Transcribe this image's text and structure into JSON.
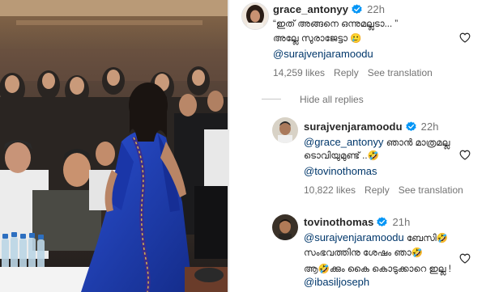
{
  "comments": [
    {
      "username": "grace_antonyy",
      "time": "22h",
      "lines": [
        "“ഇത് അങ്ങനെ ഒന്നുമല്ലടാ... ”",
        "അല്ലേ സുരാജേട്ടാ 🥲"
      ],
      "mention": "@surajvenjaramoodu",
      "likes": "14,259 likes",
      "reply": "Reply",
      "translate": "See translation"
    },
    {
      "username": "surajvenjaramoodu",
      "time": "22h",
      "mention_first": "@grace_antonyy",
      "text_after_mention": "ഞാൻ മാത്രമല്ല",
      "lines": [
        "ടൊവിയുമുണ്ട് ..🤣"
      ],
      "mention": "@tovinothomas",
      "likes": "10,822 likes",
      "reply": "Reply",
      "translate": "See translation"
    },
    {
      "username": "tovinothomas",
      "time": "21h",
      "mention_first": "@surajvenjaramoodu",
      "text_after_mention": "ബേസി🤣",
      "lines": [
        "സംഭവത്തിനു ശേഷം ഞാ🤣",
        "ആ🤣ക്കും കൈ കൊടുക്കാറെ ഇല്ല !"
      ],
      "mention": "@ibasiljoseph"
    }
  ],
  "hide_replies": "Hide all replies",
  "icons": {
    "verified": "verified-badge-icon",
    "heart": "heart-outline-icon"
  },
  "colors": {
    "verified": "#0095f6",
    "mention": "#00376b",
    "muted": "#737373",
    "saree": "#1f3fae"
  }
}
